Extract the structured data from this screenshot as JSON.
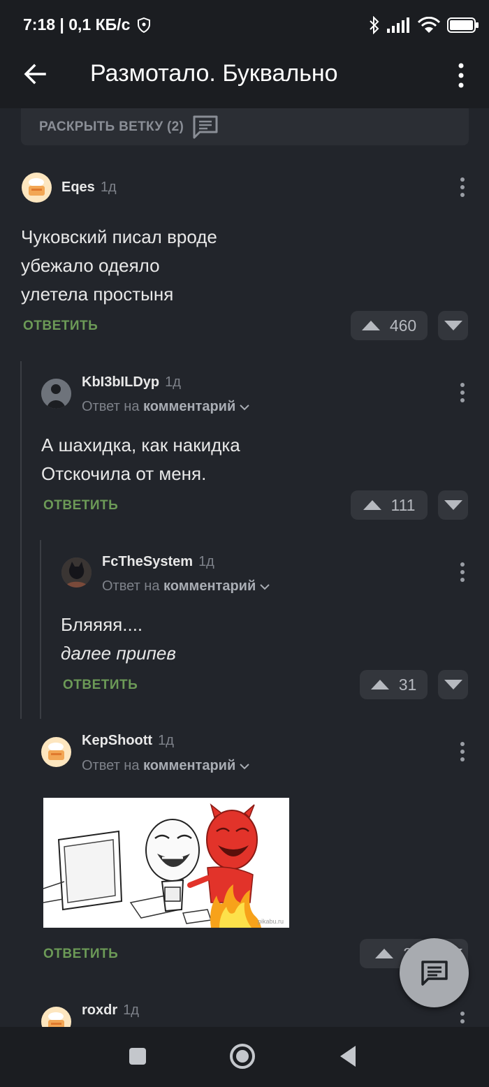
{
  "status_bar": {
    "time": "7:18 | 0,1 КБ/с"
  },
  "app_bar": {
    "title": "Размотало. Буквально"
  },
  "expand_thread": {
    "label": "РАСКРЫТЬ ВЕТКУ (2)"
  },
  "comments": [
    {
      "author": "Eqes",
      "time": "1д",
      "lines": [
        "Чуковский писал вроде",
        "убежало одеяло",
        "улетела простыня"
      ],
      "reply_label": "ОТВЕТИТЬ",
      "votes": "460"
    },
    {
      "author": "KbI3bILDyp",
      "time": "1д",
      "reply_to_prefix": "Ответ на",
      "reply_to_target": "комментарий",
      "lines": [
        "А шахидка, как накидка",
        "Отскочила от меня."
      ],
      "reply_label": "ОТВЕТИТЬ",
      "votes": "111"
    },
    {
      "author": "FcTheSystem",
      "time": "1д",
      "reply_to_prefix": "Ответ на",
      "reply_to_target": "комментарий",
      "lines": [
        "Бляяяя....",
        "далее припев"
      ],
      "reply_label": "ОТВЕТИТЬ",
      "votes": "31"
    },
    {
      "author": "KepShoott",
      "time": "1д",
      "reply_to_prefix": "Ответ на",
      "reply_to_target": "комментарий",
      "image_watermark": "pikabu.ru",
      "reply_label": "ОТВЕТИТЬ",
      "votes": "2"
    },
    {
      "author": "roxdr",
      "time": "1д"
    }
  ],
  "icons": {
    "back": "arrow-left-icon",
    "more": "more-vert-icon",
    "comments": "comment-icon",
    "vote_up": "triangle-up-icon",
    "vote_down": "triangle-down-icon",
    "fab": "chat-icon",
    "nav": [
      "square-icon",
      "circle-icon",
      "back-triangle-icon"
    ]
  },
  "colors": {
    "background": "#22252b",
    "bar": "#1b1d21",
    "reply_green": "#6c9a57",
    "vote_bg": "#33363c"
  }
}
